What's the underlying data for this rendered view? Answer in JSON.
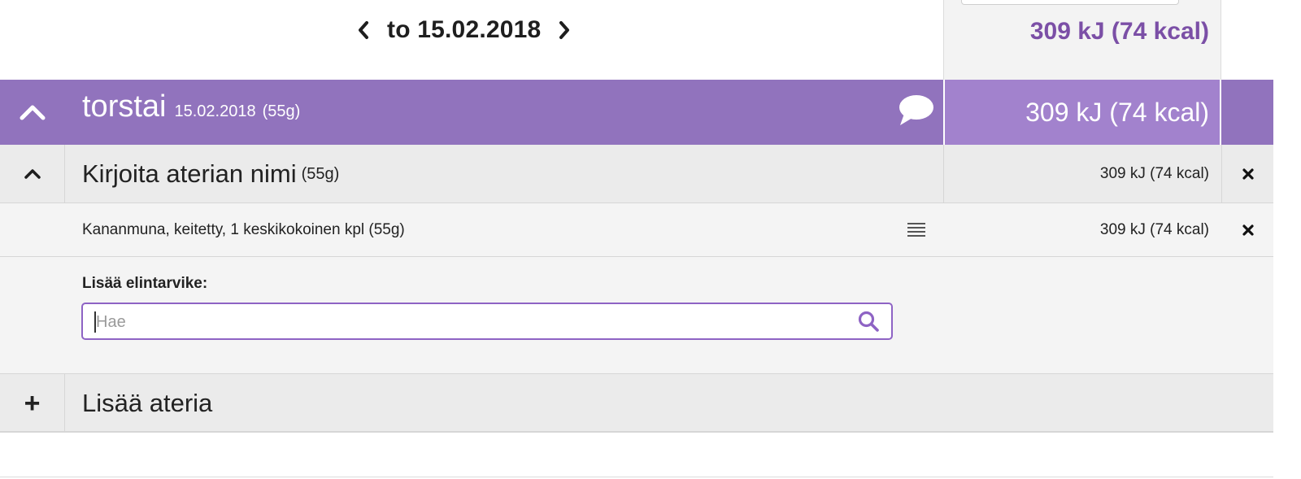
{
  "date_nav": {
    "label": "to 15.02.2018",
    "prev_icon": "chevron-left-icon",
    "next_icon": "chevron-right-icon"
  },
  "summary": {
    "total": "309 kJ (74 kcal)"
  },
  "day": {
    "name": "torstai",
    "date": "15.02.2018",
    "weight": "(55g)",
    "total": "309 kJ (74 kcal)",
    "toggle_icon": "chevron-up-icon",
    "comment_icon": "speech-bubble-icon"
  },
  "meal": {
    "name": "Kirjoita aterian nimi",
    "weight": "(55g)",
    "total": "309 kJ (74 kcal)"
  },
  "food": {
    "name": "Kananmuna, keitetty, 1 keskikokoinen kpl (55g)",
    "total": "309 kJ (74 kcal)"
  },
  "add_food": {
    "label": "Lisää elintarvike:",
    "placeholder": "Hae",
    "value": ""
  },
  "add_meal": {
    "plus": "+",
    "label": "Lisää ateria"
  },
  "colors": {
    "accent": "#9173bd",
    "accent_light": "#a282cd",
    "total_text": "#7b4fa6"
  }
}
